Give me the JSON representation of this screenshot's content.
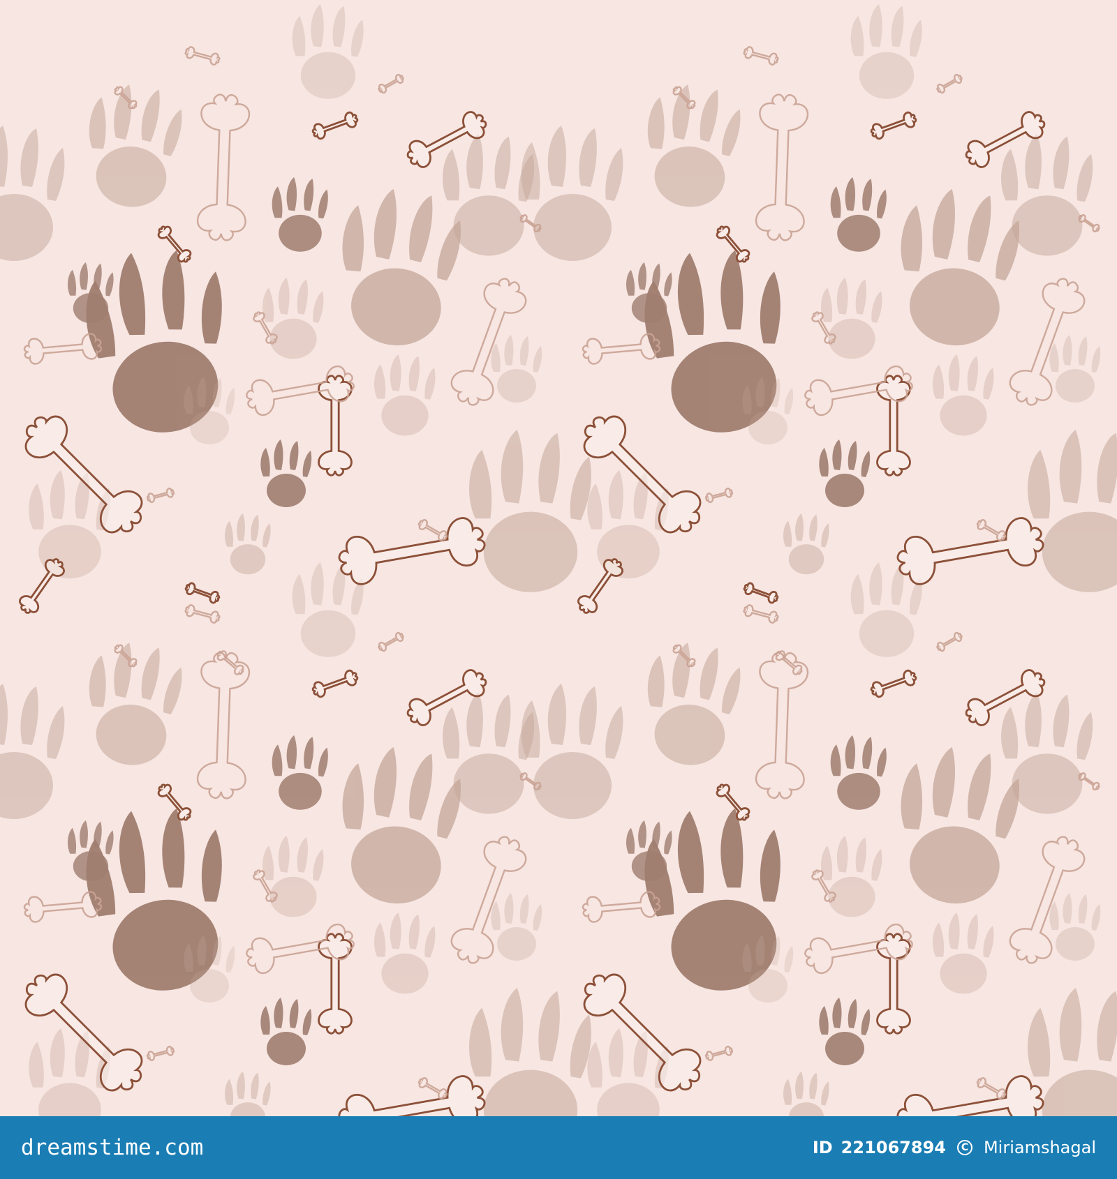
{
  "pattern": {
    "background": "#f7e6e2",
    "paw_dark": "#a07e70",
    "paw_light": "#c5a799",
    "bone_stroke": "#8c5038",
    "bone_faint": "#c9a293",
    "bone_fill": "#fbf0ed"
  },
  "watermark": {
    "brand": "dreamstime.com",
    "id_label": "ID",
    "id_value": "221067894",
    "copyright_icon": "copyright-icon",
    "photographer": "Miriamshagal",
    "bar_color": "#1a7eb5"
  }
}
